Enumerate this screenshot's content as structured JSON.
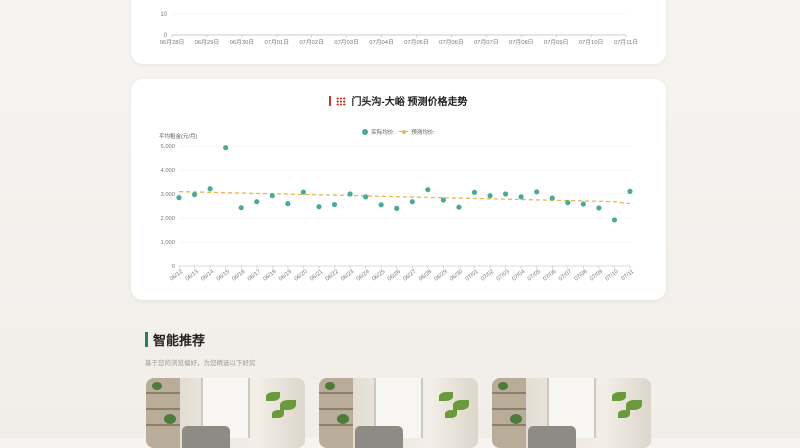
{
  "top_chart": {
    "y_tick": "10",
    "y_zero": "0",
    "x_labels": [
      "06月28日",
      "06月29日",
      "06月30日",
      "07月01日",
      "07月02日",
      "07月03日",
      "07月04日",
      "07月05日",
      "07月06日",
      "07月07日",
      "07月08日",
      "07月09日",
      "07月10日",
      "07月11日"
    ]
  },
  "trend": {
    "title": "门头沟-大峪 预测价格走势",
    "y_axis_title": "平均租金(元/月)",
    "legend_actual": "实际均价",
    "legend_predicted": "预测均价",
    "colors": {
      "actual": "#4aaa9a",
      "predicted": "#e8b84a"
    }
  },
  "chart_data": {
    "type": "scatter",
    "ylim": [
      0,
      5000
    ],
    "yticks": [
      "0",
      "1,000",
      "2,000",
      "3,000",
      "4,000",
      "5,000"
    ],
    "x": [
      "06/12",
      "06/13",
      "06/14",
      "06/15",
      "06/16",
      "06/17",
      "06/18",
      "06/19",
      "06/20",
      "06/21",
      "06/22",
      "06/23",
      "06/24",
      "06/25",
      "06/26",
      "06/27",
      "06/28",
      "06/29",
      "06/30",
      "07/01",
      "07/02",
      "07/03",
      "07/04",
      "07/05",
      "07/06",
      "07/07",
      "07/08",
      "07/09",
      "07/10",
      "07/11"
    ],
    "series": [
      {
        "name": "实际均价",
        "values": [
          2850,
          2980,
          3220,
          4930,
          2430,
          2680,
          2930,
          2600,
          3080,
          2470,
          2560,
          3000,
          2880,
          2550,
          2400,
          2680,
          3180,
          2750,
          2450,
          3070,
          2930,
          3000,
          2880,
          3090,
          2830,
          2640,
          2580,
          2420,
          1920,
          3110
        ]
      },
      {
        "name": "预测均价",
        "values": [
          3100,
          3085,
          3070,
          3055,
          3040,
          3025,
          3010,
          2995,
          2980,
          2965,
          2950,
          2935,
          2920,
          2905,
          2890,
          2875,
          2860,
          2845,
          2830,
          2815,
          2800,
          2785,
          2770,
          2755,
          2740,
          2725,
          2710,
          2695,
          2680,
          2600
        ]
      }
    ],
    "grid": true,
    "legend": "top-center"
  },
  "recommend": {
    "title": "智能推荐",
    "subtitle": "基于您的浏览偏好，为您精选以下好房"
  }
}
